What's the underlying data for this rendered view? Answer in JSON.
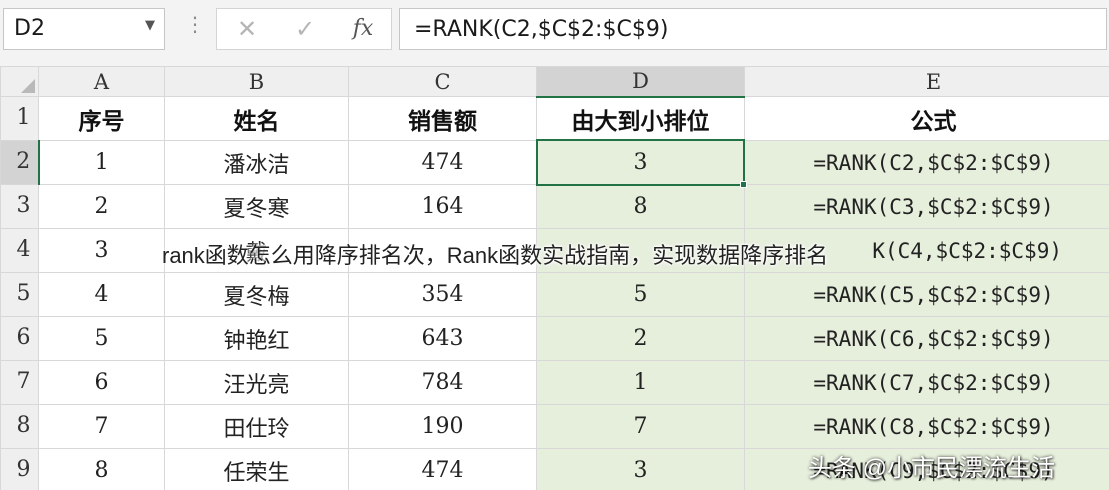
{
  "namebox": {
    "value": "D2",
    "arrow_icon": "chevron-down-icon"
  },
  "formula_bar": {
    "cancel_icon": "close-icon",
    "confirm_icon": "check-icon",
    "fx_label": "fx",
    "formula": "=RANK(C2,$C$2:$C$9)"
  },
  "columns": [
    "A",
    "B",
    "C",
    "D",
    "E"
  ],
  "rows": [
    "1",
    "2",
    "3",
    "4",
    "5",
    "6",
    "7",
    "8",
    "9"
  ],
  "table": {
    "headers": [
      "序号",
      "姓名",
      "销售额",
      "由大到小排位",
      "公式"
    ],
    "data": [
      [
        "1",
        "潘冰洁",
        "474",
        "3",
        "=RANK(C2,$C$2:$C$9)"
      ],
      [
        "2",
        "夏冬寒",
        "164",
        "8",
        "=RANK(C3,$C$2:$C$9)"
      ],
      [
        "3",
        "戴",
        "",
        "",
        "K(C4,$C$2:$C$9)"
      ],
      [
        "4",
        "夏冬梅",
        "354",
        "5",
        "=RANK(C5,$C$2:$C$9)"
      ],
      [
        "5",
        "钟艳红",
        "643",
        "2",
        "=RANK(C6,$C$2:$C$9)"
      ],
      [
        "6",
        "汪光亮",
        "784",
        "1",
        "=RANK(C7,$C$2:$C$9)"
      ],
      [
        "7",
        "田仕玲",
        "190",
        "7",
        "=RANK(C8,$C$2:$C$9)"
      ],
      [
        "8",
        "任荣生",
        "474",
        "3",
        "=RANK(C9,$C$2:$C$9)"
      ]
    ]
  },
  "overlay_title": "rank函数怎么用降序排名次，Rank函数实战指南，实现数据降序排名",
  "watermark": "头条 @小市民漂流生活",
  "colors": {
    "selection": "#217346",
    "highlight_fill": "#e6eedc",
    "header_bg": "#efefef"
  }
}
